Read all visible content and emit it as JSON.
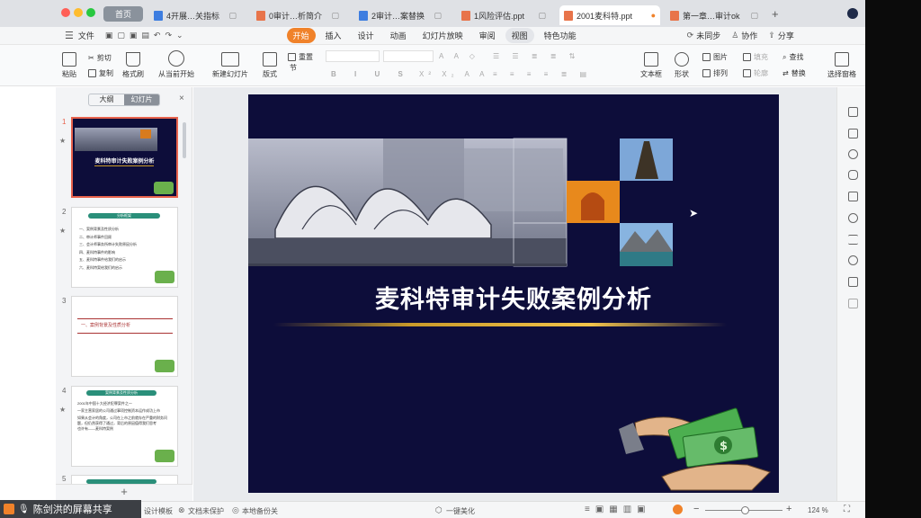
{
  "tabs": [
    {
      "label": "首页",
      "active": false
    },
    {
      "label": "4开展…关指标",
      "active": false
    },
    {
      "label": "0审计…析简介",
      "active": false
    },
    {
      "label": "2审计…案替换",
      "active": false
    },
    {
      "label": "1风险评估.ppt",
      "active": false
    },
    {
      "label": "2001麦科特.ppt",
      "active": true
    },
    {
      "label": "第一章…审计ok",
      "active": false
    }
  ],
  "menu": {
    "file": "文件",
    "tabs": [
      "开始",
      "插入",
      "设计",
      "动画",
      "幻灯片放映",
      "审阅",
      "视图",
      "特色功能"
    ],
    "sync": "未同步",
    "collab": "协作",
    "share": "分享"
  },
  "ribbon": {
    "paste": "粘贴",
    "cut": "剪切",
    "copy": "复制",
    "format_painter": "格式刷",
    "from_current": "从当前开始",
    "new_slide": "新建幻灯片",
    "layout": "版式",
    "section": "节",
    "reset": "重置",
    "text_box": "文本框",
    "shape": "形状",
    "arrange": "排列",
    "picture": "图片",
    "fill": "填充",
    "outline": "轮廓",
    "find": "查找",
    "replace": "替换",
    "select_pane": "选择窗格"
  },
  "panel": {
    "outline_tab": "大纲",
    "slides_tab": "幻灯片",
    "slides": [
      {
        "num": "1",
        "title": "麦科特审计失败案例分析"
      },
      {
        "num": "2",
        "heading": "分析框架",
        "items": [
          "一、案例背景及性质分析",
          "二、审计师事件回顾",
          "三、会计师事务所审计失败原因分析",
          "四、麦科特事件的影响",
          "五、麦科特事件给我们的启示",
          "六、麦科特案给我们的启示"
        ]
      },
      {
        "num": "3",
        "heading": "一、案例背景及性质分析"
      },
      {
        "num": "4",
        "heading": "案例背景及性质分析",
        "items": [
          "2001年中国十大经济犯罪案件之一",
          "一家主营家居的公司通过事项控制资本运作成功上市",
          "如果从会计的角度，公司在上市之前就存在严重的财务问题，但仍然获得了通过，背后的原因值得我们思考"
        ],
        "tail": "也许有——麦科特案例"
      },
      {
        "num": "5"
      }
    ]
  },
  "slide": {
    "title": "麦科特审计失败案例分析"
  },
  "status": {
    "template": "设计模板",
    "unprotected": "文档未保护",
    "backup": "本地备份关",
    "beautify": "一键美化",
    "zoom": "124 %"
  },
  "screen_share": "陈剑洪的屏幕共享",
  "colors": {
    "accent": "#f0822a",
    "slide_bg": "#0d0d3a",
    "selected_thumb": "#e8624c"
  }
}
